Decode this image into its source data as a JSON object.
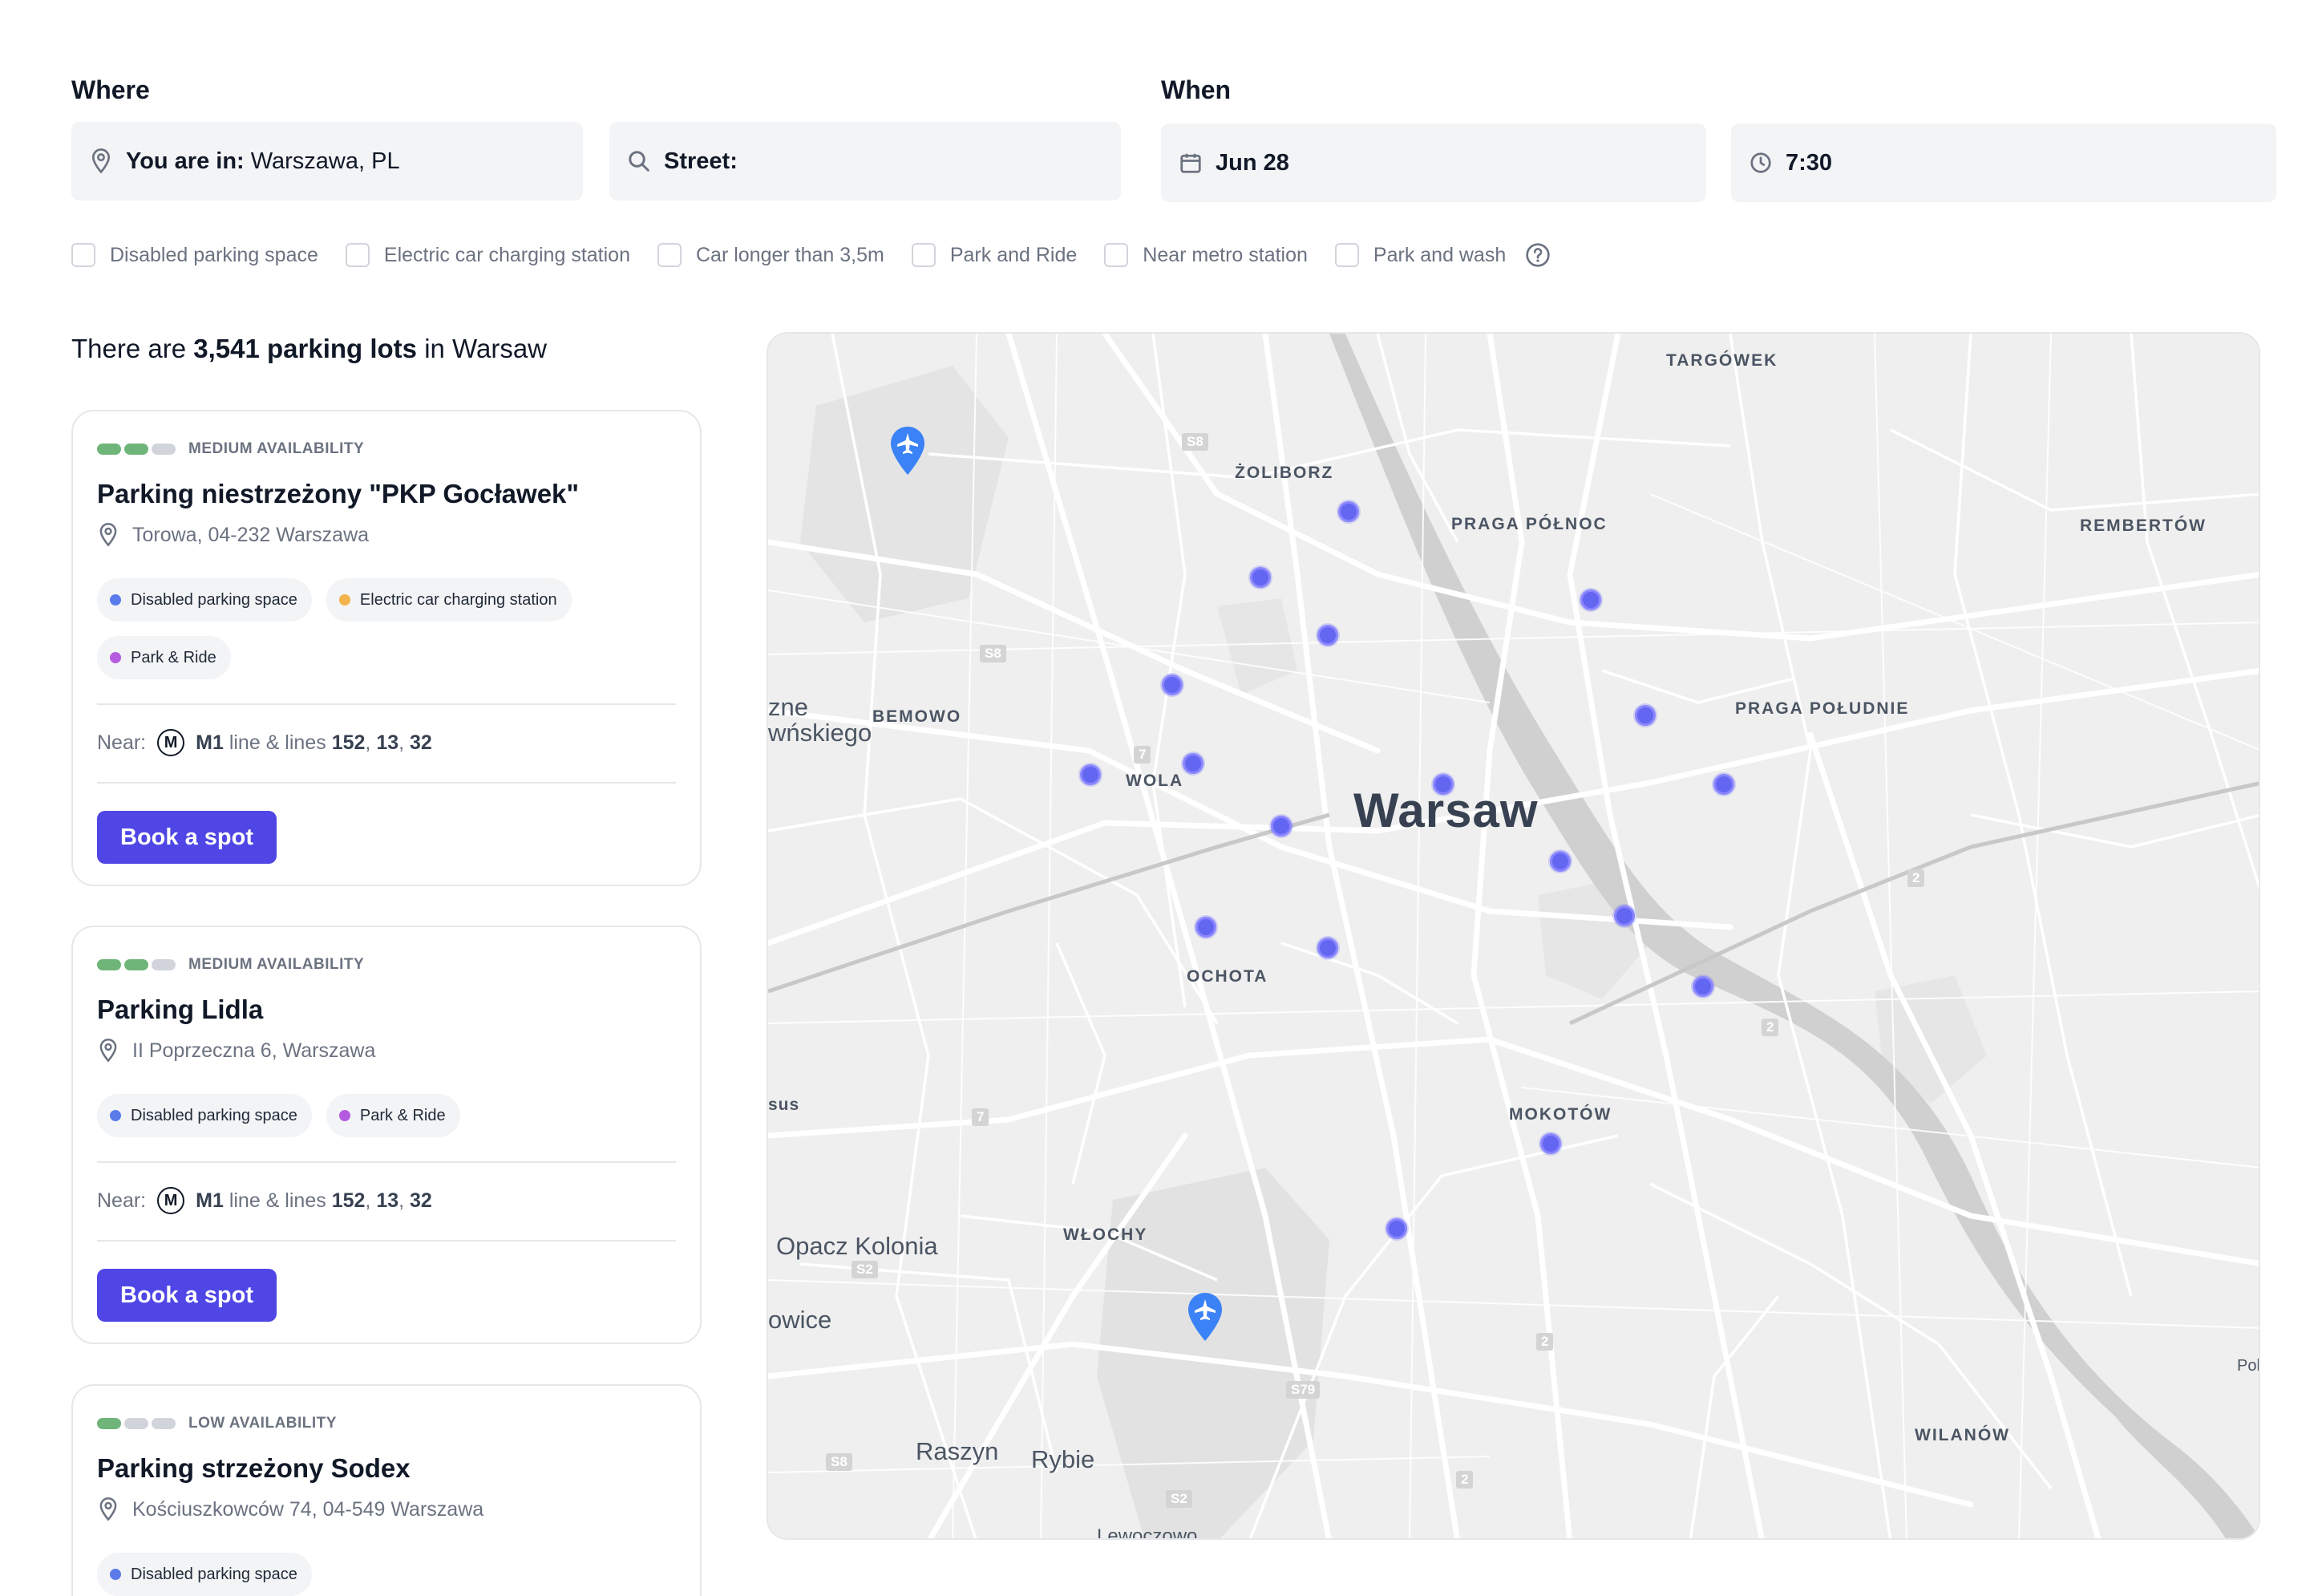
{
  "search": {
    "where_label": "Where",
    "when_label": "When",
    "location_prefix": "You are in:",
    "location_value": "Warszawa, PL",
    "street_label": "Street:",
    "date_value": "Jun 28",
    "time_value": "7:30"
  },
  "filters": [
    {
      "label": "Disabled parking space",
      "checked": false
    },
    {
      "label": "Electric car charging station",
      "checked": false
    },
    {
      "label": "Car longer than 3,5m",
      "checked": false
    },
    {
      "label": "Park and Ride",
      "checked": false
    },
    {
      "label": "Near metro station",
      "checked": false
    },
    {
      "label": "Park and wash",
      "checked": false
    }
  ],
  "results": {
    "prefix": "There are",
    "count": "3,541 parking lots",
    "suffix": "in Warsaw"
  },
  "cards": [
    {
      "availability": "MEDIUM AVAILABILITY",
      "availability_level": 2,
      "title": "Parking niestrzeżony \"PKP Gocławek\"",
      "address": "Torowa, 04-232 Warszawa",
      "tags": [
        {
          "label": "Disabled parking space",
          "color": "#5b7bea"
        },
        {
          "label": "Electric car charging station",
          "color": "#f2b34c"
        },
        {
          "label": "Park & Ride",
          "color": "#b45be0"
        }
      ],
      "near_label": "Near:",
      "metro_letter": "M",
      "line": "M1",
      "lines_text": "line & lines",
      "lines": [
        "152",
        "13",
        "32"
      ],
      "button": "Book a spot"
    },
    {
      "availability": "MEDIUM AVAILABILITY",
      "availability_level": 2,
      "title": "Parking Lidla",
      "address": "II Poprzeczna 6, Warszawa",
      "tags": [
        {
          "label": "Disabled parking space",
          "color": "#5b7bea"
        },
        {
          "label": "Park & Ride",
          "color": "#b45be0"
        }
      ],
      "near_label": "Near:",
      "metro_letter": "M",
      "line": "M1",
      "lines_text": "line & lines",
      "lines": [
        "152",
        "13",
        "32"
      ],
      "button": "Book a spot"
    },
    {
      "availability": "LOW AVAILABILITY",
      "availability_level": 1,
      "title": "Parking strzeżony Sodex",
      "address": "Kościuszkowców 74, 04-549 Warszawa",
      "tags": [
        {
          "label": "Disabled parking space",
          "color": "#5b7bea"
        }
      ]
    }
  ],
  "map": {
    "city": "Warsaw",
    "districts": [
      "TARGÓWEK",
      "ŻOLIBORZ",
      "PRAGA PÓŁNOC",
      "REMBERTÓW",
      "BEMOWO",
      "PRAGA POŁUDNIE",
      "WOLA",
      "OCHOTA",
      "MOKOTÓW",
      "WŁOCHY",
      "WILANÓW"
    ],
    "towns": [
      "Opacz Kolonia",
      "Raszyn",
      "Rybie",
      "zne",
      "wńskiego",
      "owice",
      "sus",
      "Lewoczowo",
      "Polu"
    ],
    "road_shields": [
      "S8",
      "S8",
      "7",
      "2",
      "2",
      "7",
      "S2",
      "S79",
      "2",
      "S8",
      "S2",
      "2"
    ],
    "pin_color": "#6366f1",
    "airport_color": "#3b82f6"
  },
  "colors": {
    "accent": "#4f46e5",
    "availability_on": "#6fb57a",
    "availability_off": "#d1d5db"
  }
}
